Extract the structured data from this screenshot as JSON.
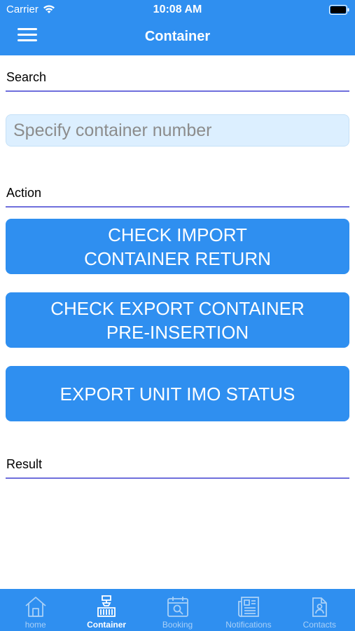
{
  "status_bar": {
    "carrier": "Carrier",
    "time": "10:08 AM",
    "icons": [
      "wifi-icon",
      "battery-icon"
    ]
  },
  "nav": {
    "title": "Container",
    "menu_icon": "hamburger-menu-icon"
  },
  "search": {
    "label": "Search",
    "placeholder": "Specify container number",
    "value": ""
  },
  "action": {
    "label": "Action",
    "buttons": [
      {
        "line1": "CHECK IMPORT",
        "line2": "CONTAINER RETURN"
      },
      {
        "line1": "CHECK EXPORT CONTAINER",
        "line2": "PRE-INSERTION"
      },
      {
        "line1": "EXPORT UNIT IMO STATUS",
        "line2": ""
      }
    ]
  },
  "result": {
    "label": "Result"
  },
  "tabbar": {
    "items": [
      {
        "label": "home",
        "icon": "home-icon",
        "active": false
      },
      {
        "label": "Container",
        "icon": "container-crane-icon",
        "active": true
      },
      {
        "label": "Booking",
        "icon": "calendar-search-icon",
        "active": false
      },
      {
        "label": "Notifications",
        "icon": "newspaper-icon",
        "active": false
      },
      {
        "label": "Contacts",
        "icon": "contact-card-icon",
        "active": false
      }
    ]
  },
  "colors": {
    "primary": "#2f8ff0",
    "underline": "#6f6fdc",
    "input_bg": "#dcefff",
    "tab_inactive": "#a9d0f7"
  }
}
